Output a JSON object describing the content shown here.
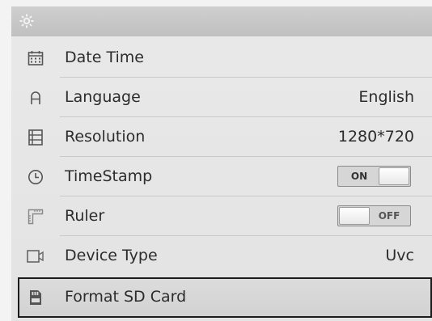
{
  "header": {
    "icon": "gear-icon"
  },
  "menu": {
    "items": [
      {
        "label": "Date Time",
        "value": "",
        "icon": "calendar-icon"
      },
      {
        "label": "Language",
        "value": "English",
        "icon": "language-a-icon"
      },
      {
        "label": "Resolution",
        "value": "1280*720",
        "icon": "film-icon"
      },
      {
        "label": "TimeStamp",
        "toggle": "ON",
        "state": "on",
        "icon": "clock-icon"
      },
      {
        "label": "Ruler",
        "toggle": "OFF",
        "state": "off",
        "icon": "ruler-icon"
      },
      {
        "label": "Device Type",
        "value": "Uvc",
        "icon": "camera-icon"
      },
      {
        "label": "Format SD Card",
        "value": "",
        "icon": "sd-card-icon",
        "selected": true
      }
    ]
  }
}
